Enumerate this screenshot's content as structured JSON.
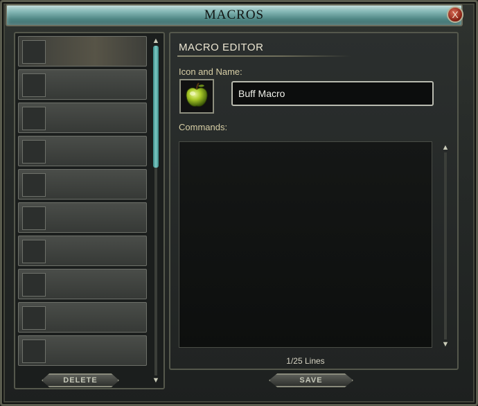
{
  "window": {
    "title": "MACROS",
    "close_label": "X"
  },
  "macro_list": {
    "slots": [
      {
        "selected": true
      },
      {
        "selected": false
      },
      {
        "selected": false
      },
      {
        "selected": false
      },
      {
        "selected": false
      },
      {
        "selected": false
      },
      {
        "selected": false
      },
      {
        "selected": false
      },
      {
        "selected": false
      },
      {
        "selected": false
      }
    ],
    "delete_label": "DELETE"
  },
  "editor": {
    "heading": "MACRO EDITOR",
    "icon_name_label": "Icon and Name:",
    "icon": "green-apple-icon",
    "name_value": "Buff Macro",
    "commands_label": "Commands:",
    "commands_value": "",
    "line_count": "1/25 Lines",
    "save_label": "SAVE"
  },
  "colors": {
    "accent": "#7cc9c4",
    "close": "#8a2416"
  }
}
